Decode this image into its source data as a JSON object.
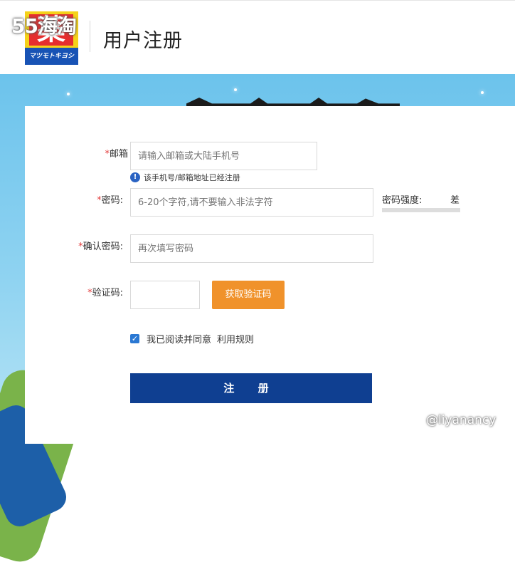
{
  "header": {
    "logo_text": "薬",
    "logo_subtext": "マツモトキヨシ",
    "title": "用户注册",
    "watermark": "55海淘"
  },
  "form": {
    "email": {
      "label": "邮箱",
      "placeholder": "请输入邮箱或大陆手机号",
      "hint": "该手机号/邮箱地址已经注册"
    },
    "password": {
      "label": "密码:",
      "placeholder": "6-20个字符,请不要输入非法字符",
      "strength_label": "密码强度:",
      "strength_value": "差",
      "strength_level": 0
    },
    "confirm": {
      "label": "确认密码:",
      "placeholder": "再次填写密码"
    },
    "captcha": {
      "label": "验证码:",
      "value": "",
      "button": "获取验证码"
    },
    "agree": {
      "checked": true,
      "text": "我已阅读并同意",
      "terms": "利用规则"
    },
    "submit": "注 册",
    "required_mark": "*"
  },
  "watermark_bottom": "@liyanancy",
  "colors": {
    "brand_blue": "#0f3f91",
    "accent_orange": "#f0922b",
    "required_red": "#e23b3b",
    "sky": "#6cc3ec"
  }
}
